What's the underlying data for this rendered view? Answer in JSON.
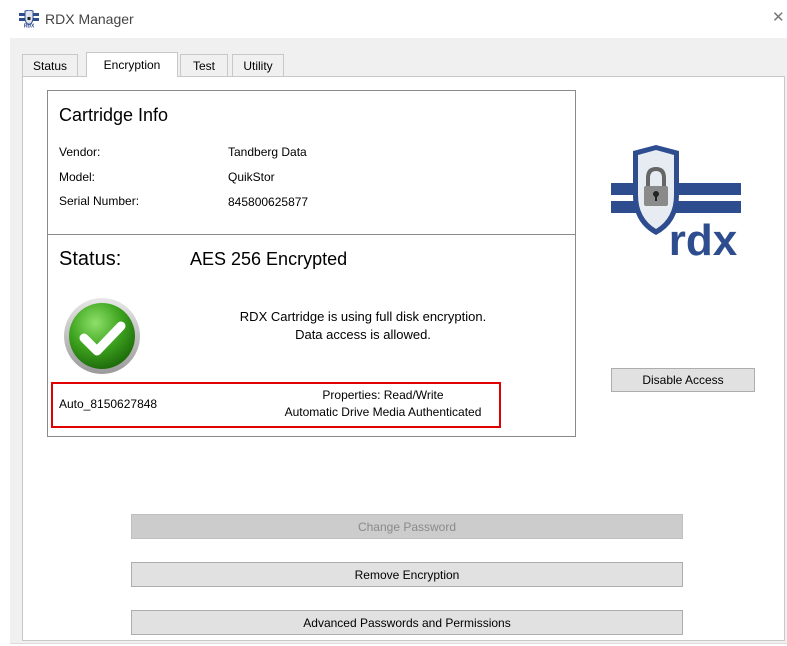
{
  "window": {
    "title": "RDX Manager",
    "close_glyph": "✕"
  },
  "tabs": [
    {
      "label": "Status"
    },
    {
      "label": "Encryption",
      "active": true
    },
    {
      "label": "Test"
    },
    {
      "label": "Utility"
    }
  ],
  "cartridge": {
    "heading": "Cartridge Info",
    "vendor_label": "Vendor:",
    "vendor_value": "Tandberg Data",
    "model_label": "Model:",
    "model_value": "QuikStor",
    "serial_label": "Serial Number:",
    "serial_value": "845800625877"
  },
  "status": {
    "label": "Status:",
    "value": "AES 256 Encrypted",
    "message_line1": "RDX Cartridge is using full disk encryption.",
    "message_line2": "Data access is allowed.",
    "auto_id": "Auto_8150627848",
    "properties_line1": "Properties: Read/Write",
    "properties_line2": "Automatic Drive Media Authenticated"
  },
  "buttons": {
    "disable_access": "Disable Access",
    "change_password": "Change Password",
    "remove_encryption": "Remove Encryption",
    "advanced": "Advanced Passwords and Permissions"
  },
  "logo": {
    "text": "rdx"
  },
  "icons": {
    "app": "rdx-app-icon",
    "status": "green-checkmark-icon",
    "logo": "rdx-shield-lock-logo"
  },
  "colors": {
    "highlight_box": "#e00000",
    "check_green": "#3fa51f",
    "logo_blue": "#2e4d8f"
  }
}
